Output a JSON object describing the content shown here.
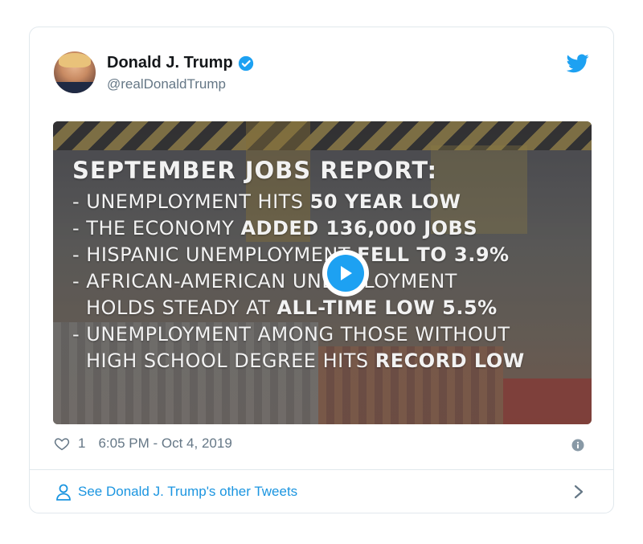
{
  "tweet": {
    "display_name": "Donald J. Trump",
    "handle": "@realDonaldTrump",
    "likes": "1",
    "timestamp": "6:05 PM - Oct 4, 2019",
    "see_other": "See Donald J. Trump's other Tweets"
  },
  "media": {
    "headline": "SEPTEMBER JOBS REPORT:",
    "lines": [
      {
        "pre": "- UNEMPLOYMENT HITS ",
        "bold": "50 YEAR LOW",
        "post": ""
      },
      {
        "pre": "- THE ECONOMY ",
        "bold": "ADDED 136,000 JOBS",
        "post": ""
      },
      {
        "pre": "- HISPANIC UNEMPLOYMENT ",
        "bold": "FELL TO 3.9%",
        "post": ""
      },
      {
        "pre": "- AFRICAN-AMERICAN UNEMPLOYMENT",
        "bold": "",
        "post": ""
      },
      {
        "pre": "HOLDS STEADY AT ",
        "bold": "ALL-TIME LOW 5.5%",
        "post": ""
      },
      {
        "pre": "- UNEMPLOYMENT AMONG THOSE WITHOUT",
        "bold": "",
        "post": ""
      },
      {
        "pre": "HIGH SCHOOL DEGREE HITS ",
        "bold": "RECORD LOW",
        "post": ""
      }
    ]
  },
  "icons": {
    "verified": "verified-badge-icon",
    "bird": "twitter-bird-icon",
    "play": "play-icon",
    "heart": "heart-icon",
    "info": "info-icon",
    "person": "person-icon",
    "chevron": "chevron-right-icon"
  },
  "colors": {
    "accent": "#1da1f2",
    "link": "#1b95e0",
    "muted": "#657786",
    "text": "#14171a"
  }
}
